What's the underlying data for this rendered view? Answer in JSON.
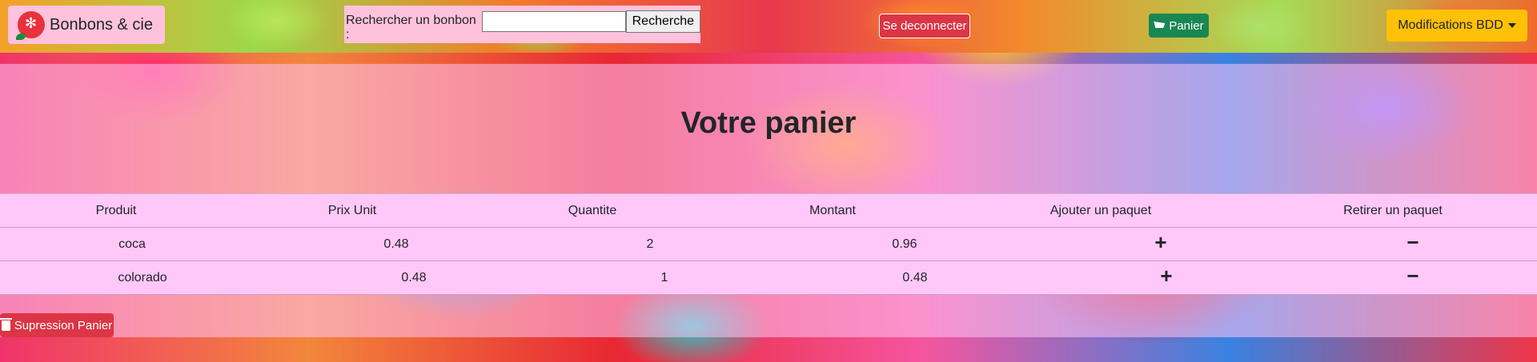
{
  "brand": {
    "name": "Bonbons & cie"
  },
  "search": {
    "label": "Rechercher un bonbon :",
    "value": "",
    "button": "Recherche"
  },
  "nav": {
    "logout": "Se deconnecter",
    "cart": "Panier",
    "bdd": "Modifications BDD"
  },
  "page": {
    "title": "Votre panier"
  },
  "table": {
    "headers": [
      "Produit",
      "Prix Unit",
      "Quantite",
      "Montant",
      "Ajouter un paquet",
      "Retirer un paquet"
    ],
    "rows": [
      {
        "produit": "coca",
        "prix": "0.48",
        "quantite": "2",
        "montant": "0.96",
        "add": "+",
        "remove": "−"
      },
      {
        "produit": "colorado",
        "prix": "0.48",
        "quantite": "1",
        "montant": "0.48",
        "add": "+",
        "remove": "−"
      }
    ]
  },
  "actions": {
    "clear_cart": "Supression Panier"
  },
  "colors": {
    "danger": "#dc3545",
    "success": "#198754",
    "warning": "#ffc107",
    "pink": "#ffc2dc"
  },
  "icons": [
    "candy-logo-icon",
    "cart-icon",
    "caret-down-icon",
    "plus-icon",
    "minus-icon",
    "trash-icon"
  ]
}
